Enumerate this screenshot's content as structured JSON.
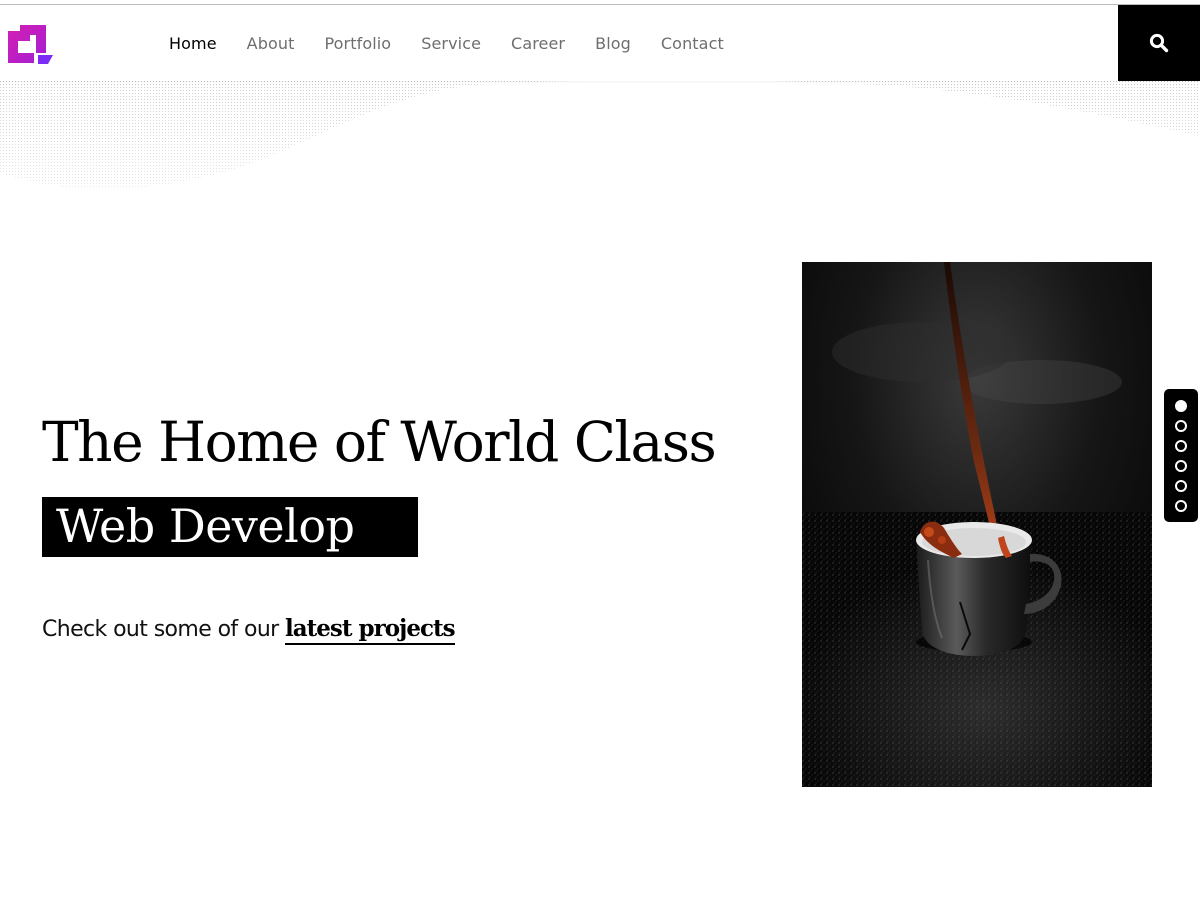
{
  "brand": {
    "logo_icon": "brand-logo-icon",
    "gradient": [
      "#d61fb0",
      "#7b2cf5"
    ]
  },
  "nav": {
    "items": [
      {
        "label": "Home",
        "active": true
      },
      {
        "label": "About",
        "active": false
      },
      {
        "label": "Portfolio",
        "active": false
      },
      {
        "label": "Service",
        "active": false
      },
      {
        "label": "Career",
        "active": false
      },
      {
        "label": "Blog",
        "active": false
      },
      {
        "label": "Contact",
        "active": false
      }
    ],
    "search_icon": "search-icon"
  },
  "hero": {
    "title": "The Home of World Class",
    "typed_text": "Web Develop",
    "cta_prefix": "Check out some of our",
    "cta_link": "latest projects"
  },
  "pager": {
    "count": 6,
    "active_index": 0
  },
  "colors": {
    "accent": "#000000",
    "background": "#ffffff",
    "nav_text": "#6e6e6e",
    "nav_active": "#000000"
  }
}
